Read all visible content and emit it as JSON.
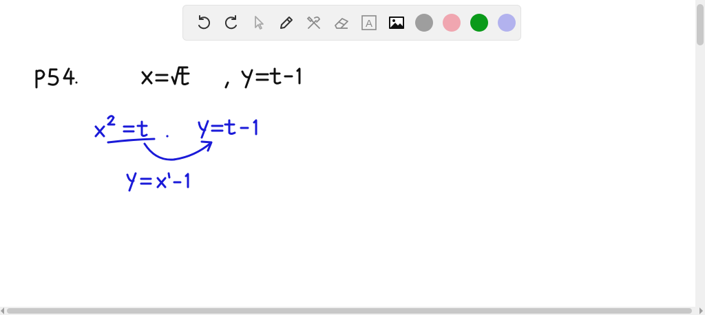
{
  "toolbar": {
    "tools": [
      {
        "name": "undo-icon"
      },
      {
        "name": "redo-icon"
      },
      {
        "name": "select-arrow-icon"
      },
      {
        "name": "pen-icon"
      },
      {
        "name": "tools-icon"
      },
      {
        "name": "eraser-icon"
      },
      {
        "name": "text-box-icon",
        "glyph": "A"
      },
      {
        "name": "image-icon"
      }
    ],
    "colors": [
      "#9e9e9e",
      "#f0a6b0",
      "#0a9a1a",
      "#b2b2ee"
    ]
  },
  "ink": {
    "black": "#111111",
    "blue": "#1a1ad8"
  }
}
